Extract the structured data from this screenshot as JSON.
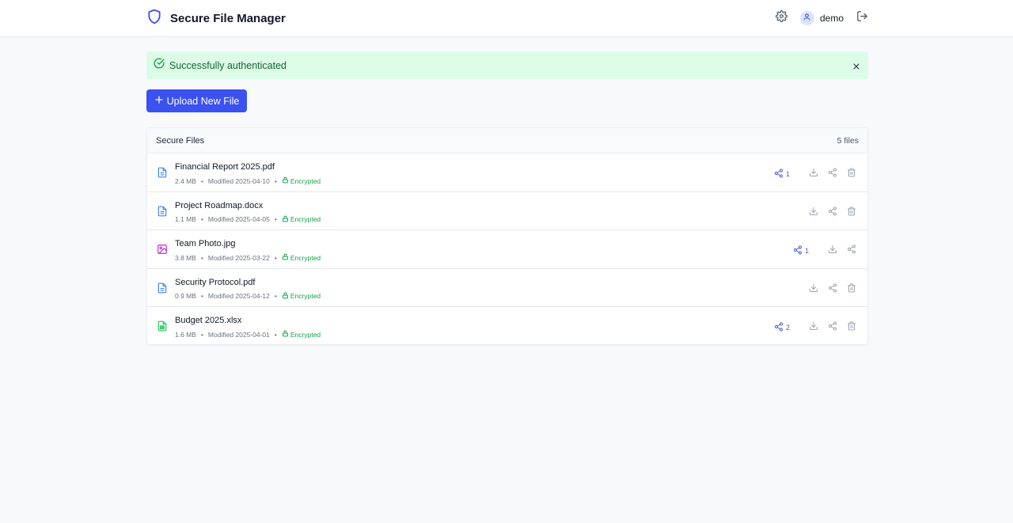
{
  "app": {
    "title": "Secure File Manager",
    "user": "demo"
  },
  "alert": {
    "message": "Successfully authenticated"
  },
  "upload_button": {
    "label": "Upload New File"
  },
  "files_panel": {
    "title": "Secure Files",
    "count": "5 files",
    "files": [
      {
        "name": "Financial Report 2025.pdf",
        "size": "2.4 MB",
        "modified": "Modified 2025-04-10",
        "encryption": "Encrypted",
        "shares": "1",
        "icon": "document-icon",
        "icon_color": "#3b82f6",
        "deletable": true
      },
      {
        "name": "Project Roadmap.docx",
        "size": "1.1 MB",
        "modified": "Modified 2025-04-05",
        "encryption": "Encrypted",
        "shares": "",
        "icon": "document-icon",
        "icon_color": "#3b82f6",
        "deletable": true
      },
      {
        "name": "Team Photo.jpg",
        "size": "3.8 MB",
        "modified": "Modified 2025-03-22",
        "encryption": "Encrypted",
        "shares": "1",
        "icon": "image-icon",
        "icon_color": "#c026d3",
        "deletable": false
      },
      {
        "name": "Security Protocol.pdf",
        "size": "0.9 MB",
        "modified": "Modified 2025-04-12",
        "encryption": "Encrypted",
        "shares": "",
        "icon": "document-icon",
        "icon_color": "#3b82f6",
        "deletable": true
      },
      {
        "name": "Budget 2025.xlsx",
        "size": "1.6 MB",
        "modified": "Modified 2025-04-01",
        "encryption": "Encrypted",
        "shares": "2",
        "icon": "spreadsheet-icon",
        "icon_color": "#22c55e",
        "deletable": true
      }
    ]
  },
  "colors": {
    "accent": "#3b51f0",
    "success_bg": "#dcfce7",
    "success_text": "#166534",
    "encrypted": "#16a34a",
    "share": "#4b5bd5"
  }
}
